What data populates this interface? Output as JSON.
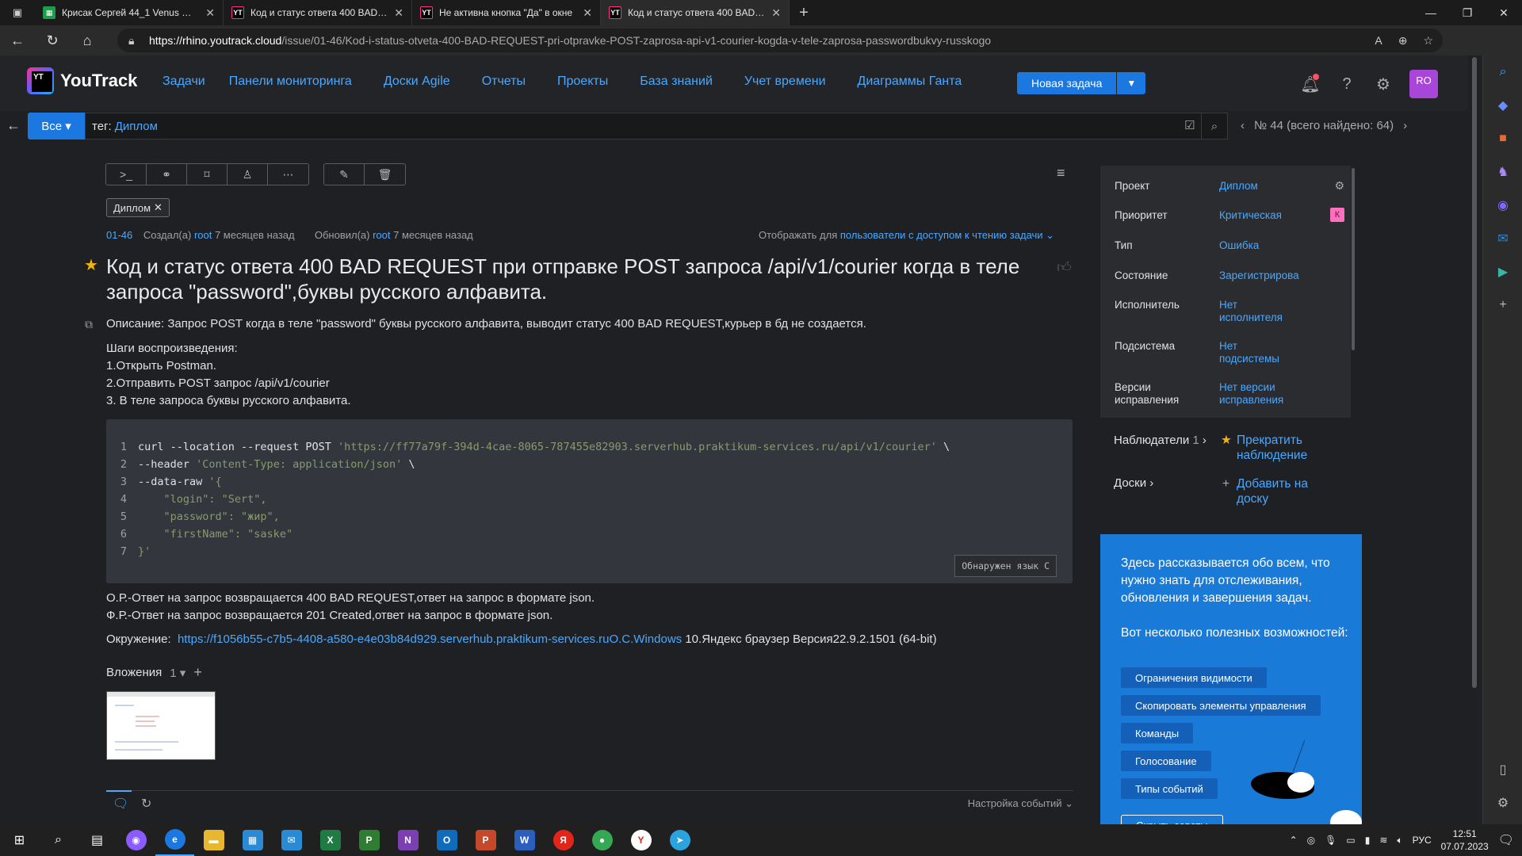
{
  "browser": {
    "tabs": [
      {
        "title": "Крисак Сергей 44_1 Venus — д",
        "fav_color": "#1f9c4b",
        "fav_text": ""
      },
      {
        "title": "Код и статус ответа 400 BAD RE",
        "fav_color": "#000000",
        "fav_text": "YT"
      },
      {
        "title": "Не активна кнопка \"Да\" в окне",
        "fav_color": "#000000",
        "fav_text": "YT"
      },
      {
        "title": "Код и статус ответа 400 BAD RE",
        "fav_color": "#000000",
        "fav_text": "YT"
      }
    ],
    "url_host": "https://rhino.youtrack.cloud",
    "url_path": "/issue/01-46/Kod-i-status-otveta-400-BAD-REQUEST-pri-otpravke-POST-zaprosa-api-v1-courier-kogda-v-tele-zaprosa-passwordbukvy-russkogo"
  },
  "header": {
    "logo": "YouTrack",
    "logo_mark": "YT",
    "nav": [
      "Задачи",
      "Панели мониторинга",
      "Доски Agile",
      "Отчеты",
      "Проекты",
      "База знаний",
      "Учет времени",
      "Диаграммы Ганта"
    ],
    "new_issue": "Новая задача",
    "avatar": "RO"
  },
  "search": {
    "scope": "Все",
    "query_key": "тег:",
    "query_value": "Диплом",
    "pager": "№ 44 (всего найдено: 64)"
  },
  "issue": {
    "tag": "Диплом",
    "id": "01-46",
    "created_label": "Создал(а)",
    "created_user": "root",
    "created_time": "7 месяцев назад",
    "updated_label": "Обновил(а)",
    "updated_user": "root",
    "updated_time": "7 месяцев назад",
    "visibility_label": "Отображать для",
    "visibility_value": "пользователи с доступом к чтению задачи",
    "title": "Код и статус ответа 400 BAD REQUEST при отправке POST запроса /api/v1/courier когда в теле запроса \"password\",буквы русского алфавита.",
    "description": "Описание: Запрос POST когда в теле \"password\" буквы русского алфавита, выводит статус 400 BAD REQUEST,курьер в бд не создается.",
    "steps_title": "Шаги воспроизведения:",
    "steps": [
      "1.Открыть Postman.",
      "2.Отправить POST запрос /api/v1/courier",
      "3. В теле запроса буквы русского алфавита."
    ],
    "code": {
      "lines": [
        {
          "n": "1",
          "pre": "curl --location --request POST ",
          "str": "'https://ff77a79f-394d-4cae-8065-787455e82903.serverhub.praktikum-services.ru/api/v1/courier'",
          "post": " \\"
        },
        {
          "n": "2",
          "pre": "--header ",
          "str": "'Content-Type: application/json'",
          "post": " \\"
        },
        {
          "n": "3",
          "pre": "--data-raw ",
          "str": "'{",
          "post": ""
        },
        {
          "n": "4",
          "pre": "    ",
          "str": "\"login\": \"Sert\",",
          "post": ""
        },
        {
          "n": "5",
          "pre": "    ",
          "str": "\"password\": \"жир\",",
          "post": ""
        },
        {
          "n": "6",
          "pre": "    ",
          "str": "\"firstName\": \"saske\"",
          "post": ""
        },
        {
          "n": "7",
          "pre": "",
          "str": "}'",
          "post": ""
        }
      ],
      "lang_badge": "Обнаружен язык C"
    },
    "expected": "О.Р.-Ответ на запрос возвращается 400 BAD REQUEST,ответ на запрос в формате json.",
    "actual": "Ф.Р.-Ответ на запрос возвращается 201 Created,ответ на запрос в формате json.",
    "env_label": "Окружение:",
    "env_link": "https://f1056b55-c7b5-4408-a580-e4e03b84d929.serverhub.praktikum-services.ruО.С.Windows",
    "env_rest": " 10.Яндекс браузер Версия22.9.2.1501 (64-bit)",
    "attachments_label": "Вложения",
    "attachments_count": "1",
    "events_settings": "Настройка событий"
  },
  "fields": [
    {
      "label": "Проект",
      "value": "Диплом"
    },
    {
      "label": "Приоритет",
      "value": "Критическая",
      "badge": "К"
    },
    {
      "label": "Тип",
      "value": "Ошибка"
    },
    {
      "label": "Состояние",
      "value": "Зарегистрирова"
    },
    {
      "label": "Исполнитель",
      "value": "Нет исполнителя"
    },
    {
      "label": "Подсистема",
      "value": "Нет подсистемы"
    },
    {
      "label": "Версии исправления",
      "value": "Нет версии исправления"
    }
  ],
  "side": {
    "watchers_label": "Наблюдатели",
    "watchers_count": "1",
    "watch_action": "Прекратить наблюдение",
    "boards_label": "Доски",
    "boards_action": "Добавить на доску"
  },
  "promo": {
    "text1": "Здесь рассказывается обо всем, что нужно знать для отслеживания, обновления и завершения задач.",
    "text2": "Вот несколько полезных возможностей:",
    "chips": [
      "Ограничения видимости",
      "Скопировать элементы управления",
      "Команды",
      "Голосование",
      "Типы событий"
    ],
    "hide": "Скрыть советы"
  },
  "taskbar": {
    "lang": "РУС",
    "time": "12:51",
    "date": "07.07.2023"
  },
  "colors": {
    "accent": "#1a78e0",
    "link": "#4aa8ff",
    "background": "#1f2023",
    "star": "#f2b30a"
  }
}
